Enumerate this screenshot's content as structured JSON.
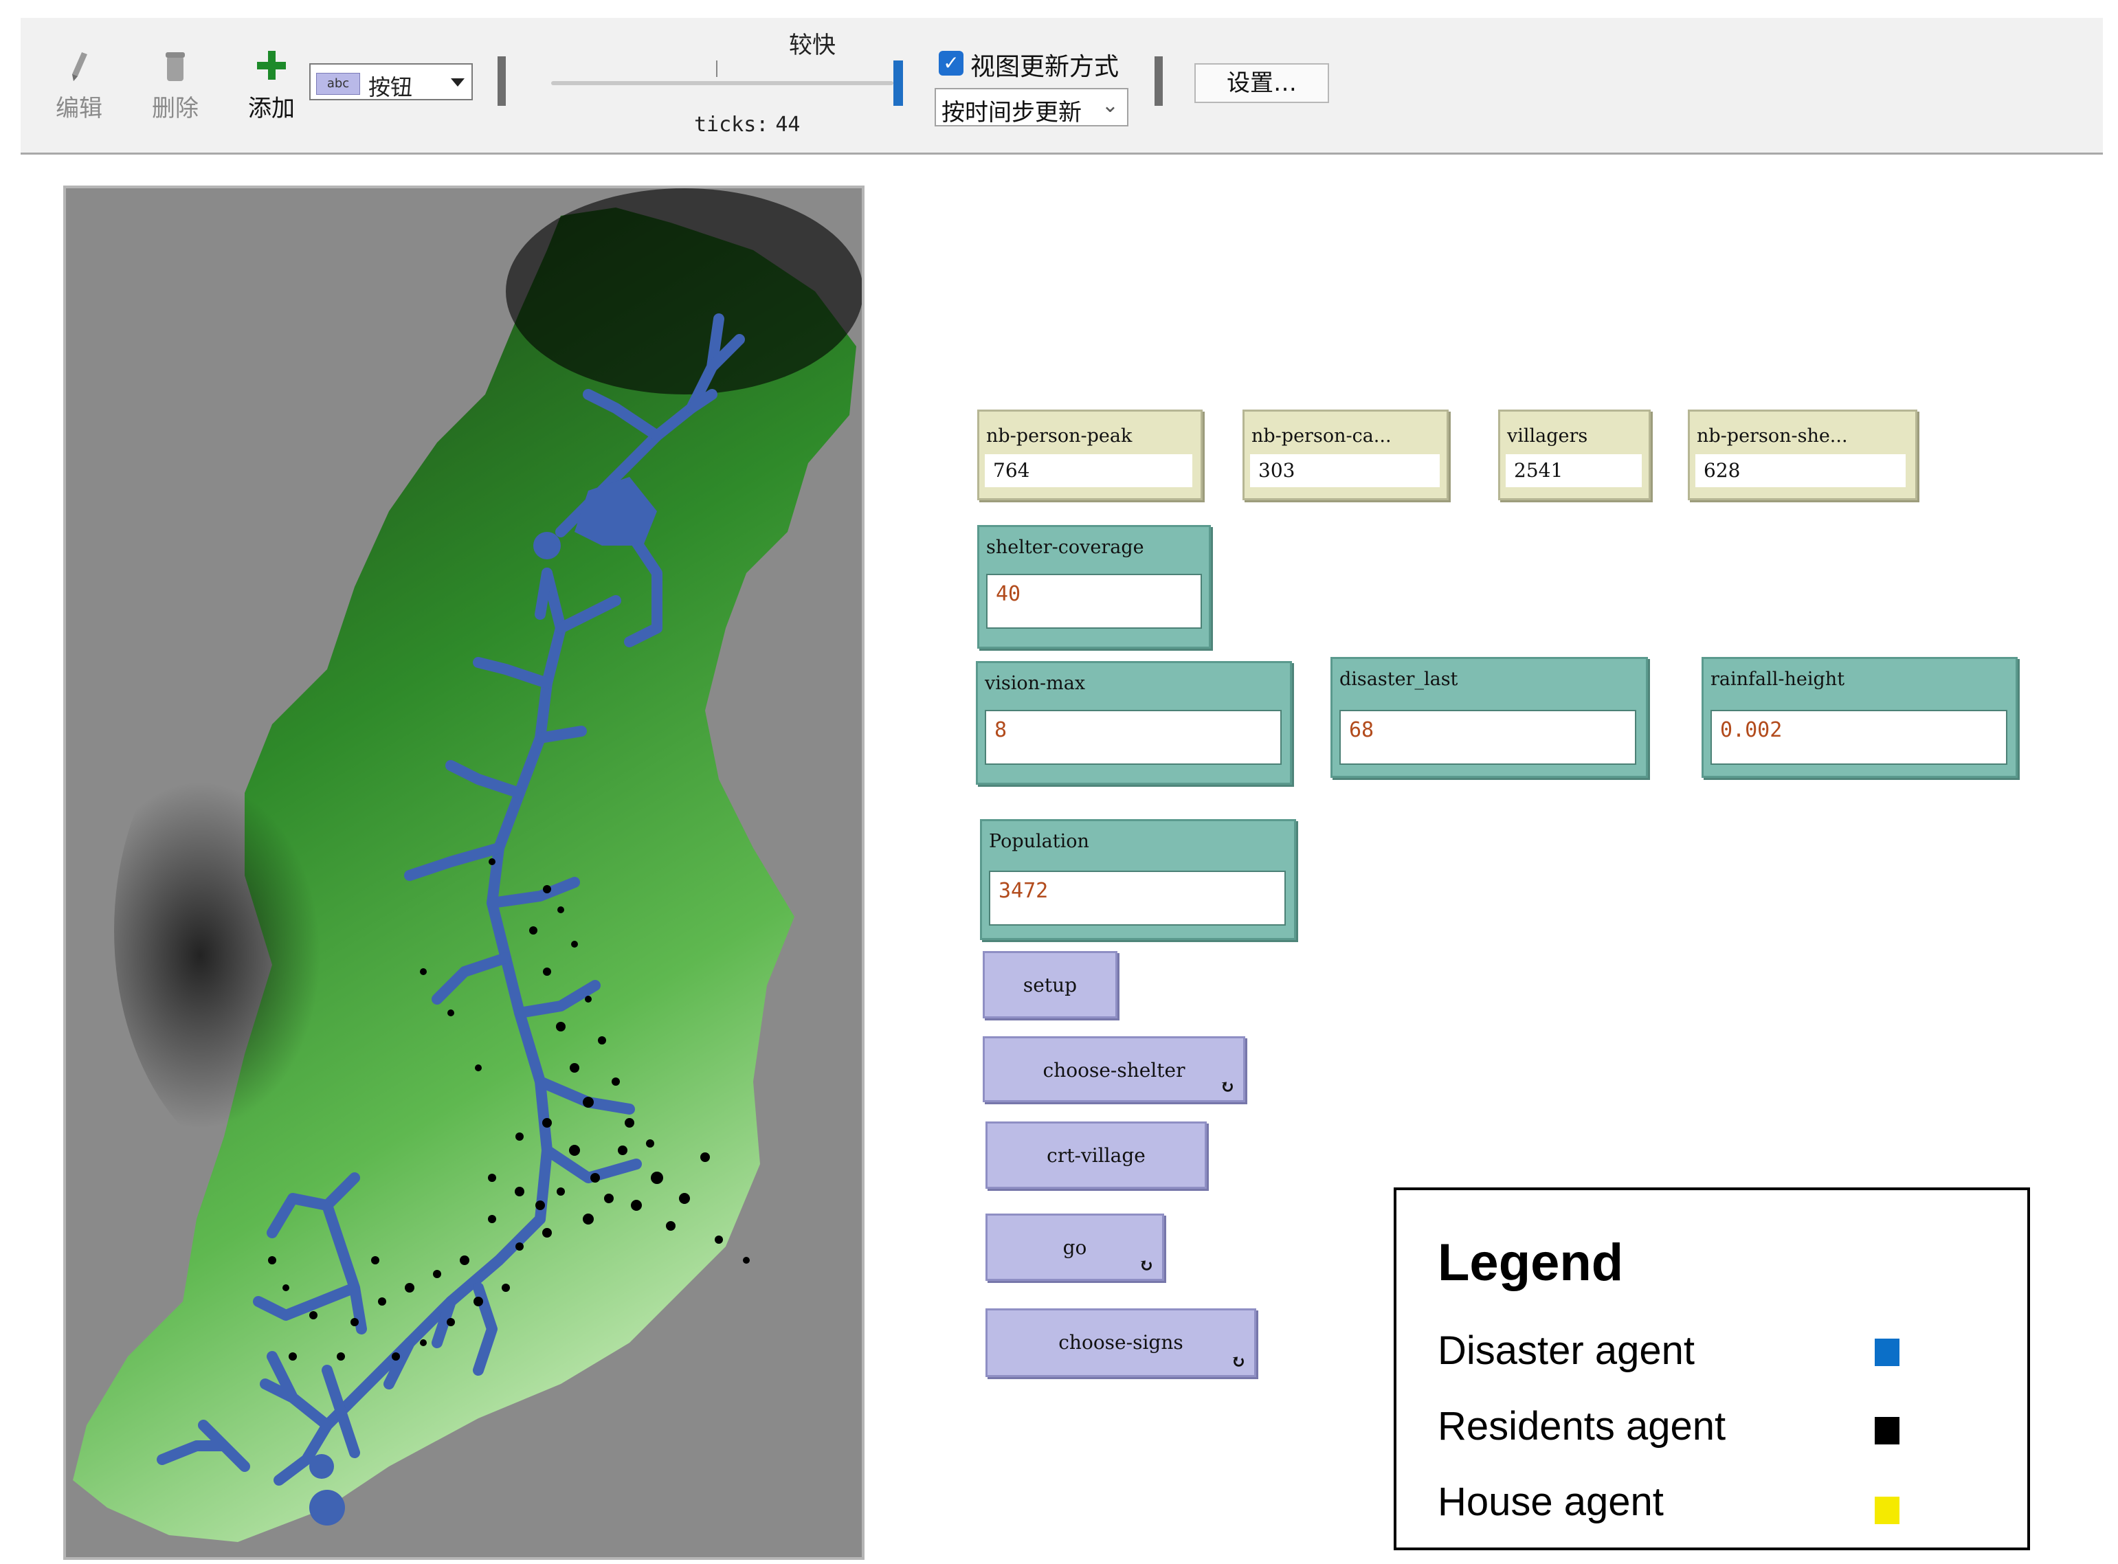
{
  "toolbar": {
    "edit_label": "编辑",
    "delete_label": "删除",
    "add_label": "添加",
    "widget_type_icon_text": "abc",
    "widget_type_value": "按钮",
    "speed_label": "较快",
    "ticks_label": "ticks:",
    "ticks_value": "44",
    "view_update_label": "视图更新方式",
    "view_update_checked": true,
    "update_mode_value": "按时间步更新",
    "settings_label": "设置…"
  },
  "monitors": [
    {
      "label": "nb-person-peak",
      "value": "764"
    },
    {
      "label": "nb-person-ca...",
      "value": "303"
    },
    {
      "label": "villagers",
      "value": "2541"
    },
    {
      "label": "nb-person-she...",
      "value": "628"
    }
  ],
  "inputs": {
    "shelter_coverage": {
      "label": "shelter-coverage",
      "value": "40"
    },
    "vision_max": {
      "label": "vision-max",
      "value": "8"
    },
    "disaster_last": {
      "label": "disaster_last",
      "value": "68"
    },
    "rainfall_height": {
      "label": "rainfall-height",
      "value": "0.002"
    },
    "population": {
      "label": "Population",
      "value": "3472"
    }
  },
  "buttons": {
    "setup": "setup",
    "choose_shelter": "choose-shelter",
    "crt_village": "crt-village",
    "go": "go",
    "choose_signs": "choose-signs"
  },
  "legend": {
    "title": "Legend",
    "items": [
      {
        "label": "Disaster agent",
        "color": "#0b6fc8"
      },
      {
        "label": "Residents agent",
        "color": "#000000"
      },
      {
        "label": "House agent",
        "color": "#f5ea00"
      }
    ]
  },
  "colors": {
    "river": "#3f63b3",
    "terrain_light": "#9bd87f",
    "terrain_dark": "#000000",
    "world_background": "#8a8a8a",
    "monitor_bg": "#e6e6c2",
    "input_bg": "#7fbdb1",
    "button_bg": "#bcbce6"
  }
}
